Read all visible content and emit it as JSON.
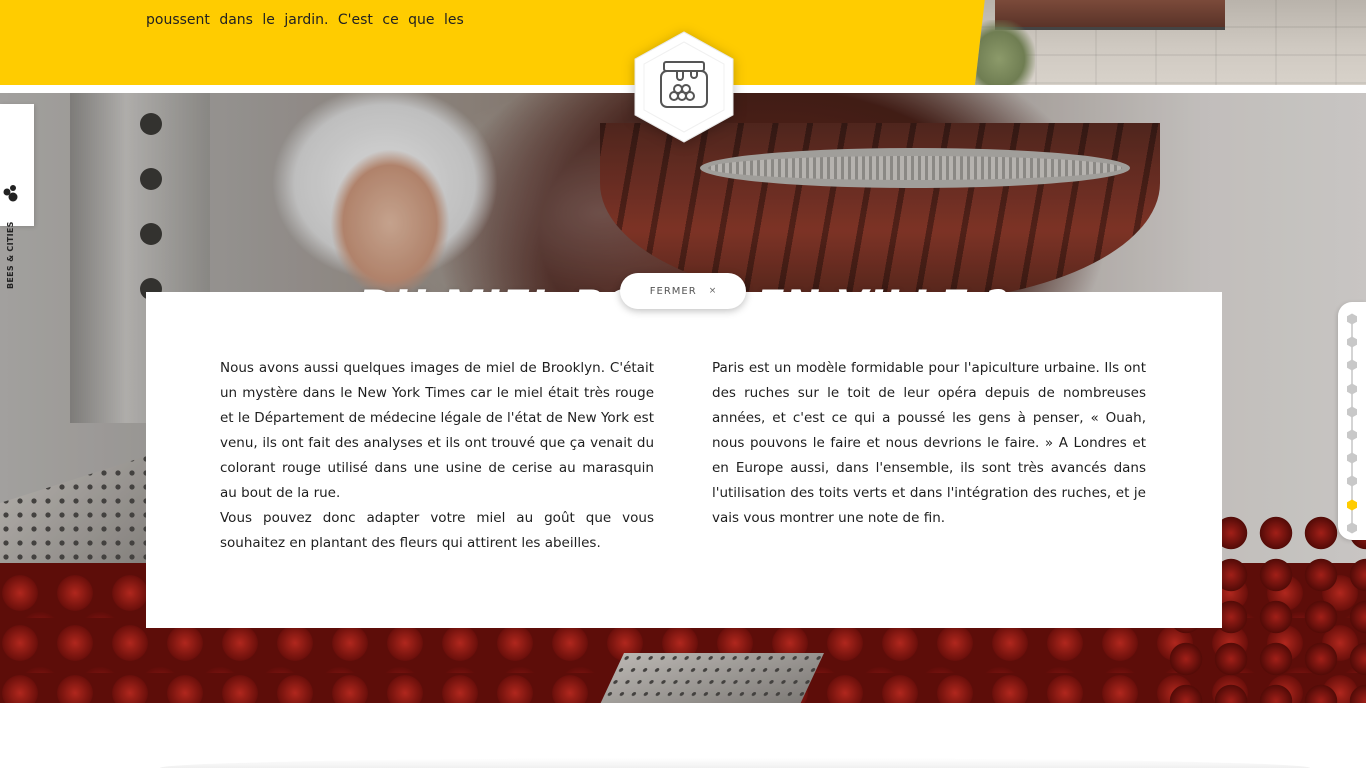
{
  "top": {
    "partial_text": "poussent dans le jardin. C'est ce que les"
  },
  "side_tab": {
    "label": "BEES & CITIES"
  },
  "hero": {
    "title": "DU MIEL ROUGE EN VILLE ?",
    "badge_icon": "honey-jar-icon"
  },
  "close_button": {
    "label": "FERMER",
    "icon_glyph": "×"
  },
  "article": {
    "left_paragraphs": [
      "Nous avons aussi quelques images de miel de Brooklyn. C'était un mystère dans le New York Times car le miel était très rouge et le Département de médecine légale de l'état de New York est venu, ils ont fait des analyses et ils ont trouvé que ça venait du colorant rouge utilisé dans une usine de cerise au marasquin au bout de la rue.",
      "Vous pouvez donc adapter votre miel au goût que vous souhaitez en plantant des fleurs qui attirent les abeilles."
    ],
    "right_paragraphs": [
      "Paris est un modèle formidable pour l'apiculture urbaine. Ils ont des ruches sur le toit de leur opéra depuis de nombreuses années, et c'est ce qui a poussé les gens à penser, « Ouah, nous pouvons le faire et nous devrions le faire. » A Londres et en Europe aussi, dans l'ensemble, ils sont très avancés dans l'utilisation des toits verts et dans l'intégration des ruches, et je vais vous montrer une note de fin."
    ]
  },
  "dot_nav": {
    "total": 10,
    "active_index": 8
  },
  "colors": {
    "accent_yellow": "#ffcc00",
    "dot_inactive": "#c8c8c8",
    "dot_active": "#ffcc00",
    "text": "#1e1e1e"
  }
}
